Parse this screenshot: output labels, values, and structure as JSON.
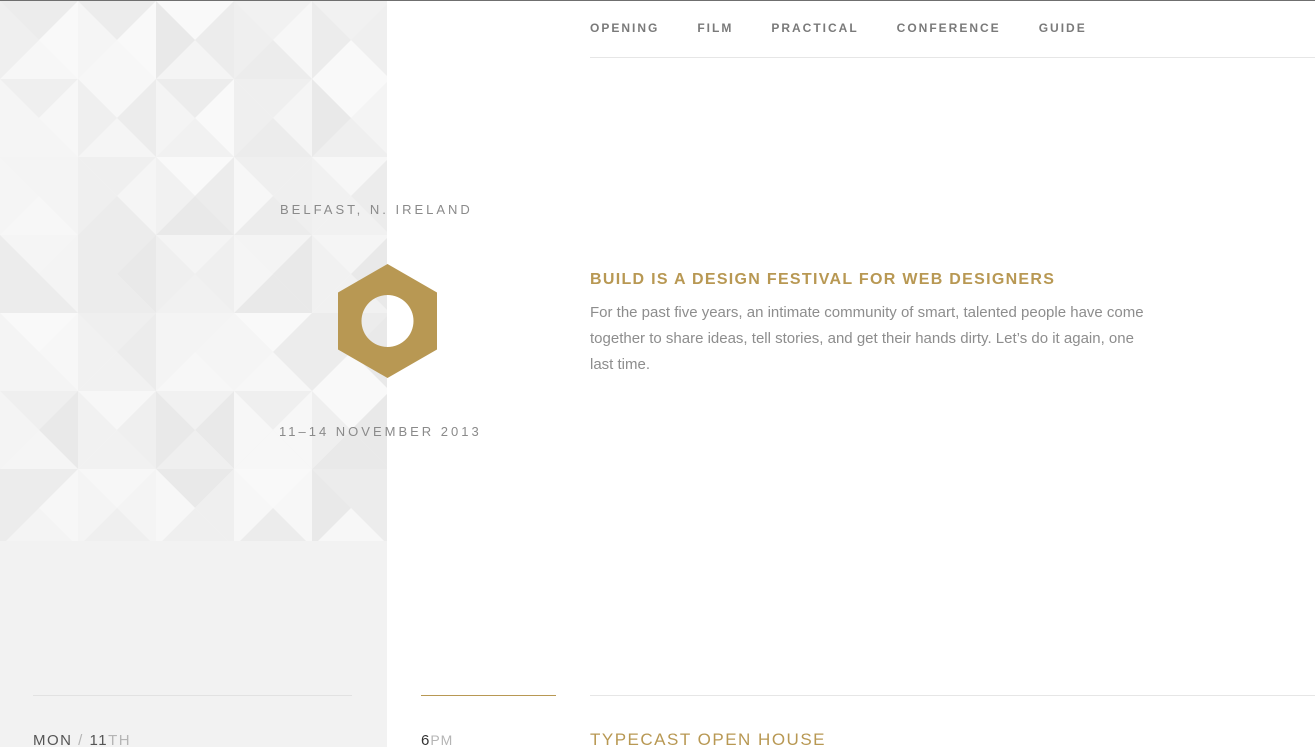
{
  "nav": {
    "items": [
      {
        "label": "OPENING"
      },
      {
        "label": "FILM"
      },
      {
        "label": "PRACTICAL"
      },
      {
        "label": "CONFERENCE"
      },
      {
        "label": "GUIDE"
      }
    ]
  },
  "event": {
    "location": "BELFAST, N. IRELAND",
    "dates": "11–14 NOVEMBER 2013",
    "logo_icon": "hexagon-nut-icon"
  },
  "intro": {
    "headline": "BUILD IS A DESIGN FESTIVAL FOR WEB DESIGNERS",
    "body": "For the past five years, an intimate community of smart, talented people have come together to share ideas, tell stories, and get their hands dirty. Let’s do it again, one last time."
  },
  "schedule": {
    "day": "MON",
    "separator": "/",
    "date_num": "11",
    "date_suffix": "TH",
    "time_num": "6",
    "time_meridiem": "PM",
    "event_title": "TYPECAST OPEN HOUSE"
  },
  "colors": {
    "accent": "#b89853",
    "text_muted": "#8d8d8d",
    "panel_bg": "#f2f2f2"
  }
}
